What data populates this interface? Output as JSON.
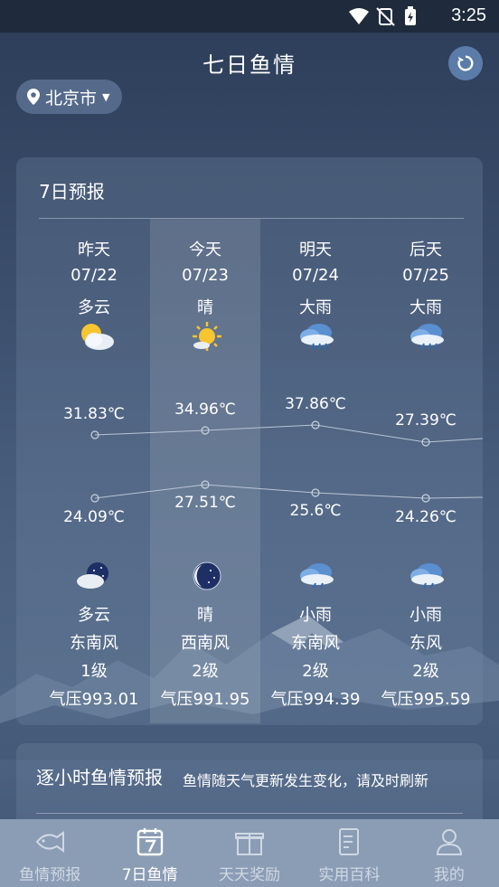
{
  "status_bar": {
    "time": "3:25"
  },
  "header": {
    "title": "七日鱼情",
    "location": "北京市"
  },
  "forecast": {
    "title": "7日预报",
    "days": [
      {
        "label": "昨天",
        "date": "07/22",
        "day_weather": "多云",
        "day_icon": "partly-cloudy-sun-icon",
        "high": "31.83℃",
        "low": "24.09℃",
        "night_icon": "partly-cloudy-moon-icon",
        "night_weather": "多云",
        "wind_dir": "东南风",
        "wind_level": "1级",
        "pressure": "气压993.01"
      },
      {
        "label": "今天",
        "date": "07/23",
        "day_weather": "晴",
        "day_icon": "sun-icon",
        "high": "34.96℃",
        "low": "27.51℃",
        "night_icon": "moon-icon",
        "night_weather": "晴",
        "wind_dir": "西南风",
        "wind_level": "2级",
        "pressure": "气压991.95"
      },
      {
        "label": "明天",
        "date": "07/24",
        "day_weather": "大雨",
        "day_icon": "heavy-rain-icon",
        "high": "37.86℃",
        "low": "25.6℃",
        "night_icon": "light-rain-icon",
        "night_weather": "小雨",
        "wind_dir": "东南风",
        "wind_level": "2级",
        "pressure": "气压994.39"
      },
      {
        "label": "后天",
        "date": "07/25",
        "day_weather": "大雨",
        "day_icon": "heavy-rain-icon",
        "high": "27.39℃",
        "low": "24.26℃",
        "night_icon": "light-rain-icon",
        "night_weather": "小雨",
        "wind_dir": "东风",
        "wind_level": "2级",
        "pressure": "气压995.59"
      }
    ]
  },
  "hourly": {
    "title": "逐小时鱼情预报",
    "subtitle": "鱼情随天气更新发生变化，请及时刷新"
  },
  "bottom_nav": {
    "items": [
      {
        "label": "鱼情预报",
        "icon": "fish-icon"
      },
      {
        "label": "7日鱼情",
        "icon": "calendar-icon"
      },
      {
        "label": "天天奖励",
        "icon": "gift-icon"
      },
      {
        "label": "实用百科",
        "icon": "document-icon"
      },
      {
        "label": "我的",
        "icon": "user-icon"
      }
    ],
    "active_index": 1
  },
  "colors": {
    "nav_bg": "#8b9db5",
    "refresh_bg": "#5b7ca8",
    "status_bg": "#1f2b3d"
  }
}
